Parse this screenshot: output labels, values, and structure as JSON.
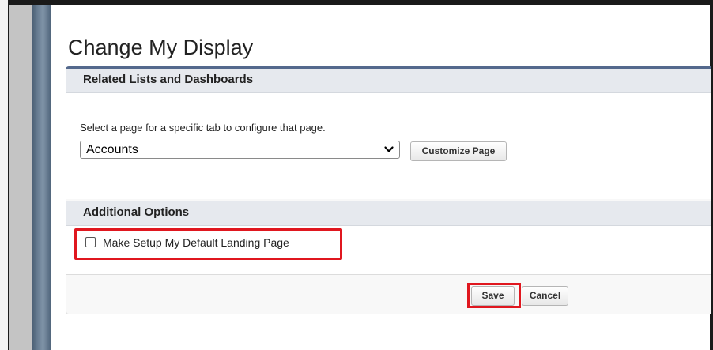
{
  "page": {
    "title": "Change My Display"
  },
  "sections": {
    "related_lists": {
      "heading": "Related Lists and Dashboards",
      "instruction": "Select a page for a specific tab to configure that page.",
      "page_select": {
        "selected": "Accounts"
      },
      "customize_label": "Customize Page"
    },
    "additional_options": {
      "heading": "Additional Options",
      "default_landing": {
        "label": "Make Setup My Default Landing Page",
        "checked": false
      }
    }
  },
  "actions": {
    "save_label": "Save",
    "cancel_label": "Cancel"
  },
  "colors": {
    "accent": "#54698d",
    "highlight": "#e0171f"
  }
}
